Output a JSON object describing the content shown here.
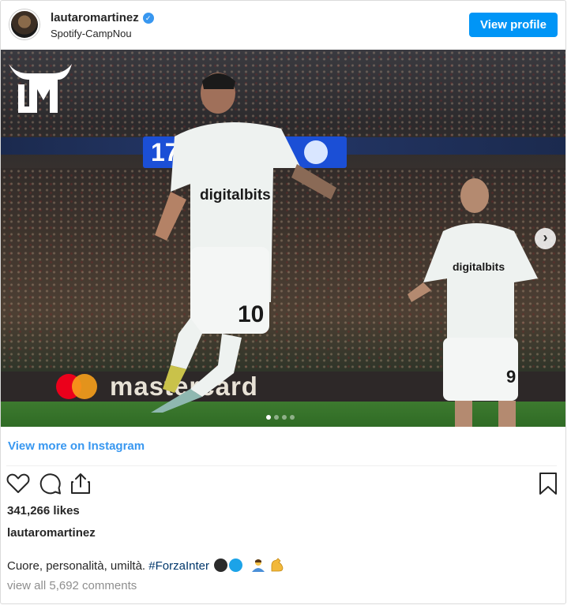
{
  "header": {
    "username": "lautaromartinez",
    "verified": true,
    "location": "Spotify-CampNou",
    "view_profile_label": "View profile"
  },
  "photo": {
    "scoreboard_text": "17",
    "adboard_text": "mastercard",
    "player_left_number": "10",
    "player_right_number": "9",
    "sponsor_text": "digitalbits",
    "carousel_count": 4,
    "carousel_active_index": 0
  },
  "view_more_label": "View more on Instagram",
  "actions": {
    "like_icon": "heart-icon",
    "comment_icon": "comment-icon",
    "share_icon": "share-icon",
    "save_icon": "bookmark-icon"
  },
  "likes_text": "341,266 likes",
  "caption": {
    "username": "lautaromartinez",
    "text": "Cuore, personalità, umiltà.",
    "hashtag": "#ForzaInter",
    "emojis": [
      "black-circle",
      "blue-circle",
      "person-gesturing",
      "flexed-biceps"
    ]
  },
  "view_comments_label": "view all 5,692 comments",
  "colors": {
    "accent": "#0095f6",
    "link": "#3897f0",
    "hashtag": "#00376b",
    "muted": "#8e8e8e"
  }
}
